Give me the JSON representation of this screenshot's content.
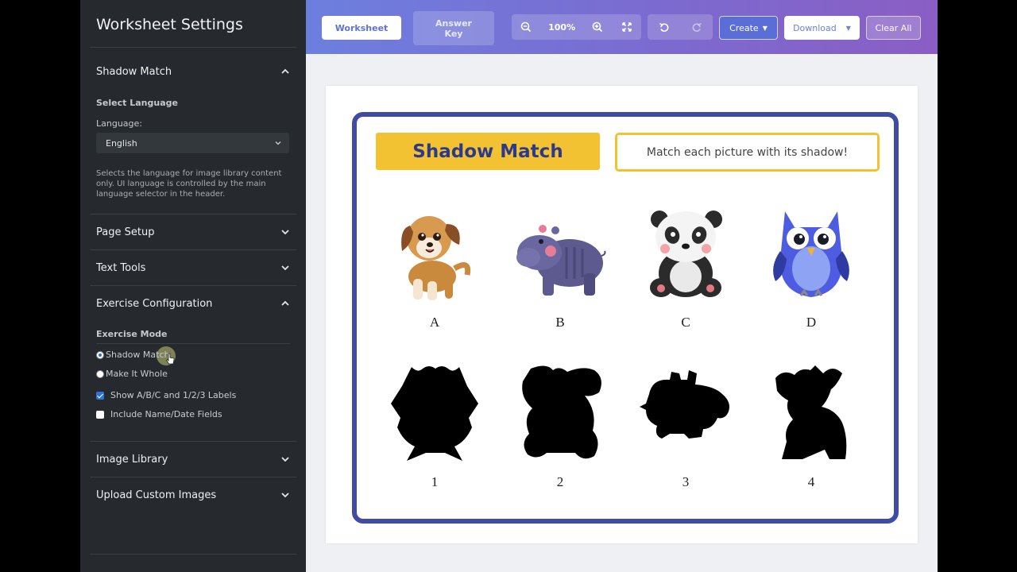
{
  "sidebar": {
    "title": "Worksheet Settings",
    "sections": {
      "shadow_match": "Shadow Match",
      "page_setup": "Page Setup",
      "text_tools": "Text Tools",
      "exercise_config": "Exercise Configuration",
      "image_library": "Image Library",
      "upload_custom": "Upload Custom Images"
    },
    "language": {
      "heading": "Select Language",
      "label": "Language:",
      "selected": "English",
      "help": "Selects the language for image library content only. UI language is controlled by the main language selector in the header."
    },
    "exercise": {
      "heading": "Exercise Mode",
      "mode_shadow": "Shadow Match",
      "mode_whole": "Make It Whole",
      "selected_mode": "Shadow Match",
      "opt_labels": "Show A/B/C and 1/2/3 Labels",
      "opt_labels_checked": true,
      "opt_name_date": "Include Name/Date Fields",
      "opt_name_date_checked": false
    }
  },
  "toolbar": {
    "worksheet": "Worksheet",
    "answer_key": "Answer Key",
    "zoom": "100%",
    "create": "Create",
    "download": "Download",
    "clear_all": "Clear All"
  },
  "worksheet": {
    "title": "Shadow Match",
    "instructions": "Match each picture with its shadow!",
    "pictures": [
      {
        "label": "A",
        "icon": "dog-icon"
      },
      {
        "label": "B",
        "icon": "hippo-icon"
      },
      {
        "label": "C",
        "icon": "panda-icon"
      },
      {
        "label": "D",
        "icon": "owl-icon"
      }
    ],
    "shadows": [
      {
        "label": "1",
        "icon": "owl-shadow-icon"
      },
      {
        "label": "2",
        "icon": "panda-shadow-icon"
      },
      {
        "label": "3",
        "icon": "hippo-shadow-icon"
      },
      {
        "label": "4",
        "icon": "dog-shadow-icon"
      }
    ]
  },
  "colors": {
    "accent": "#3f4ba5",
    "title_bg": "#f2c233",
    "sidebar_bg": "#262a2e"
  }
}
